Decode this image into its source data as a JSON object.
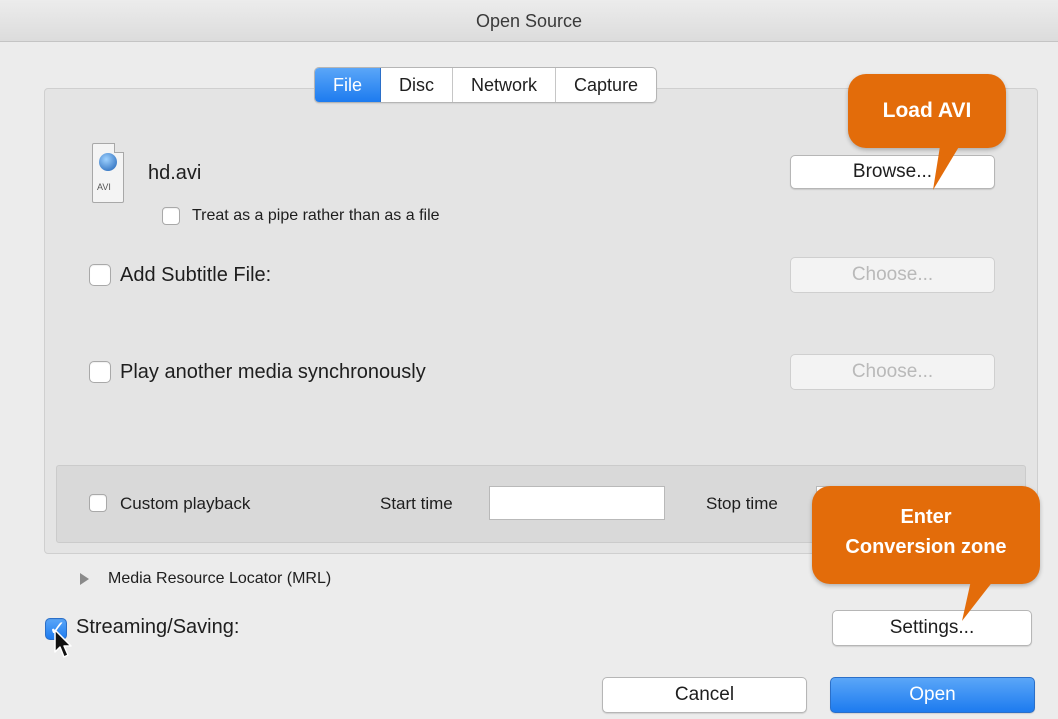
{
  "window": {
    "title": "Open Source"
  },
  "tabs": [
    {
      "label": "File",
      "active": true
    },
    {
      "label": "Disc",
      "active": false
    },
    {
      "label": "Network",
      "active": false
    },
    {
      "label": "Capture",
      "active": false
    }
  ],
  "file": {
    "icon": "avi-file-icon",
    "icon_ext": "AVI",
    "name": "hd.avi",
    "browse_label": "Browse...",
    "pipe_label": "Treat as a pipe rather than as a file",
    "pipe_checked": false
  },
  "subtitle": {
    "label": "Add Subtitle File:",
    "checked": false,
    "choose_label": "Choose..."
  },
  "sync": {
    "label": "Play another media synchronously",
    "checked": false,
    "choose_label": "Choose..."
  },
  "playback": {
    "custom_label": "Custom playback",
    "custom_checked": false,
    "start_label": "Start time",
    "start_value": "",
    "stop_label": "Stop time",
    "stop_value": ""
  },
  "mrl": {
    "label": "Media Resource Locator (MRL)",
    "expanded": false
  },
  "streaming": {
    "label": "Streaming/Saving:",
    "checked": true,
    "settings_label": "Settings..."
  },
  "footer": {
    "cancel_label": "Cancel",
    "open_label": "Open"
  },
  "callouts": {
    "load": "Load AVI",
    "enter_line1": "Enter",
    "enter_line2": "Conversion zone",
    "color": "#e36c0a"
  },
  "colors": {
    "accent": "#1d7bef",
    "window_bg": "#ececec"
  }
}
